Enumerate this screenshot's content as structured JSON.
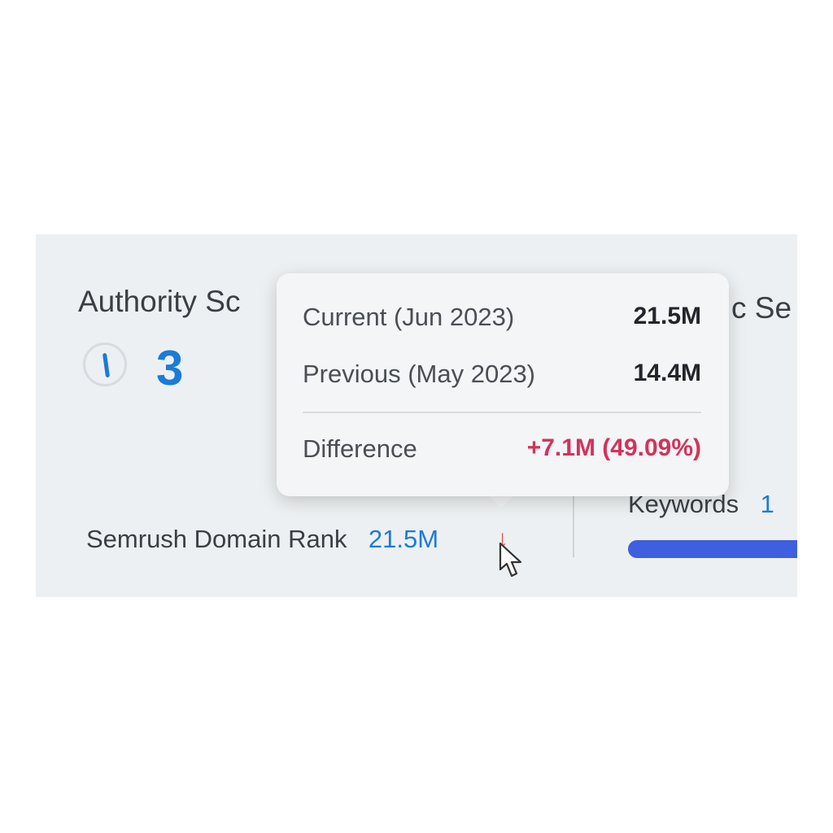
{
  "authority": {
    "label": "Authority Sc",
    "value": "3"
  },
  "traffic": {
    "label": "c Se"
  },
  "tooltip": {
    "rows": [
      {
        "label": "Current (Jun 2023)",
        "value": "21.5M"
      },
      {
        "label": "Previous (May 2023)",
        "value": "14.4M"
      }
    ],
    "difference": {
      "label": "Difference",
      "value": "+7.1M (49.09%)"
    }
  },
  "domain_rank": {
    "label": "Semrush Domain Rank",
    "value": "21.5M",
    "trend_icon": "arrow-down-icon"
  },
  "keywords": {
    "label": "Keywords",
    "value": "1"
  },
  "colors": {
    "accent": "#1b7bd6",
    "difference": "#d2335a",
    "keywords_bar": "#3d5fe0"
  }
}
